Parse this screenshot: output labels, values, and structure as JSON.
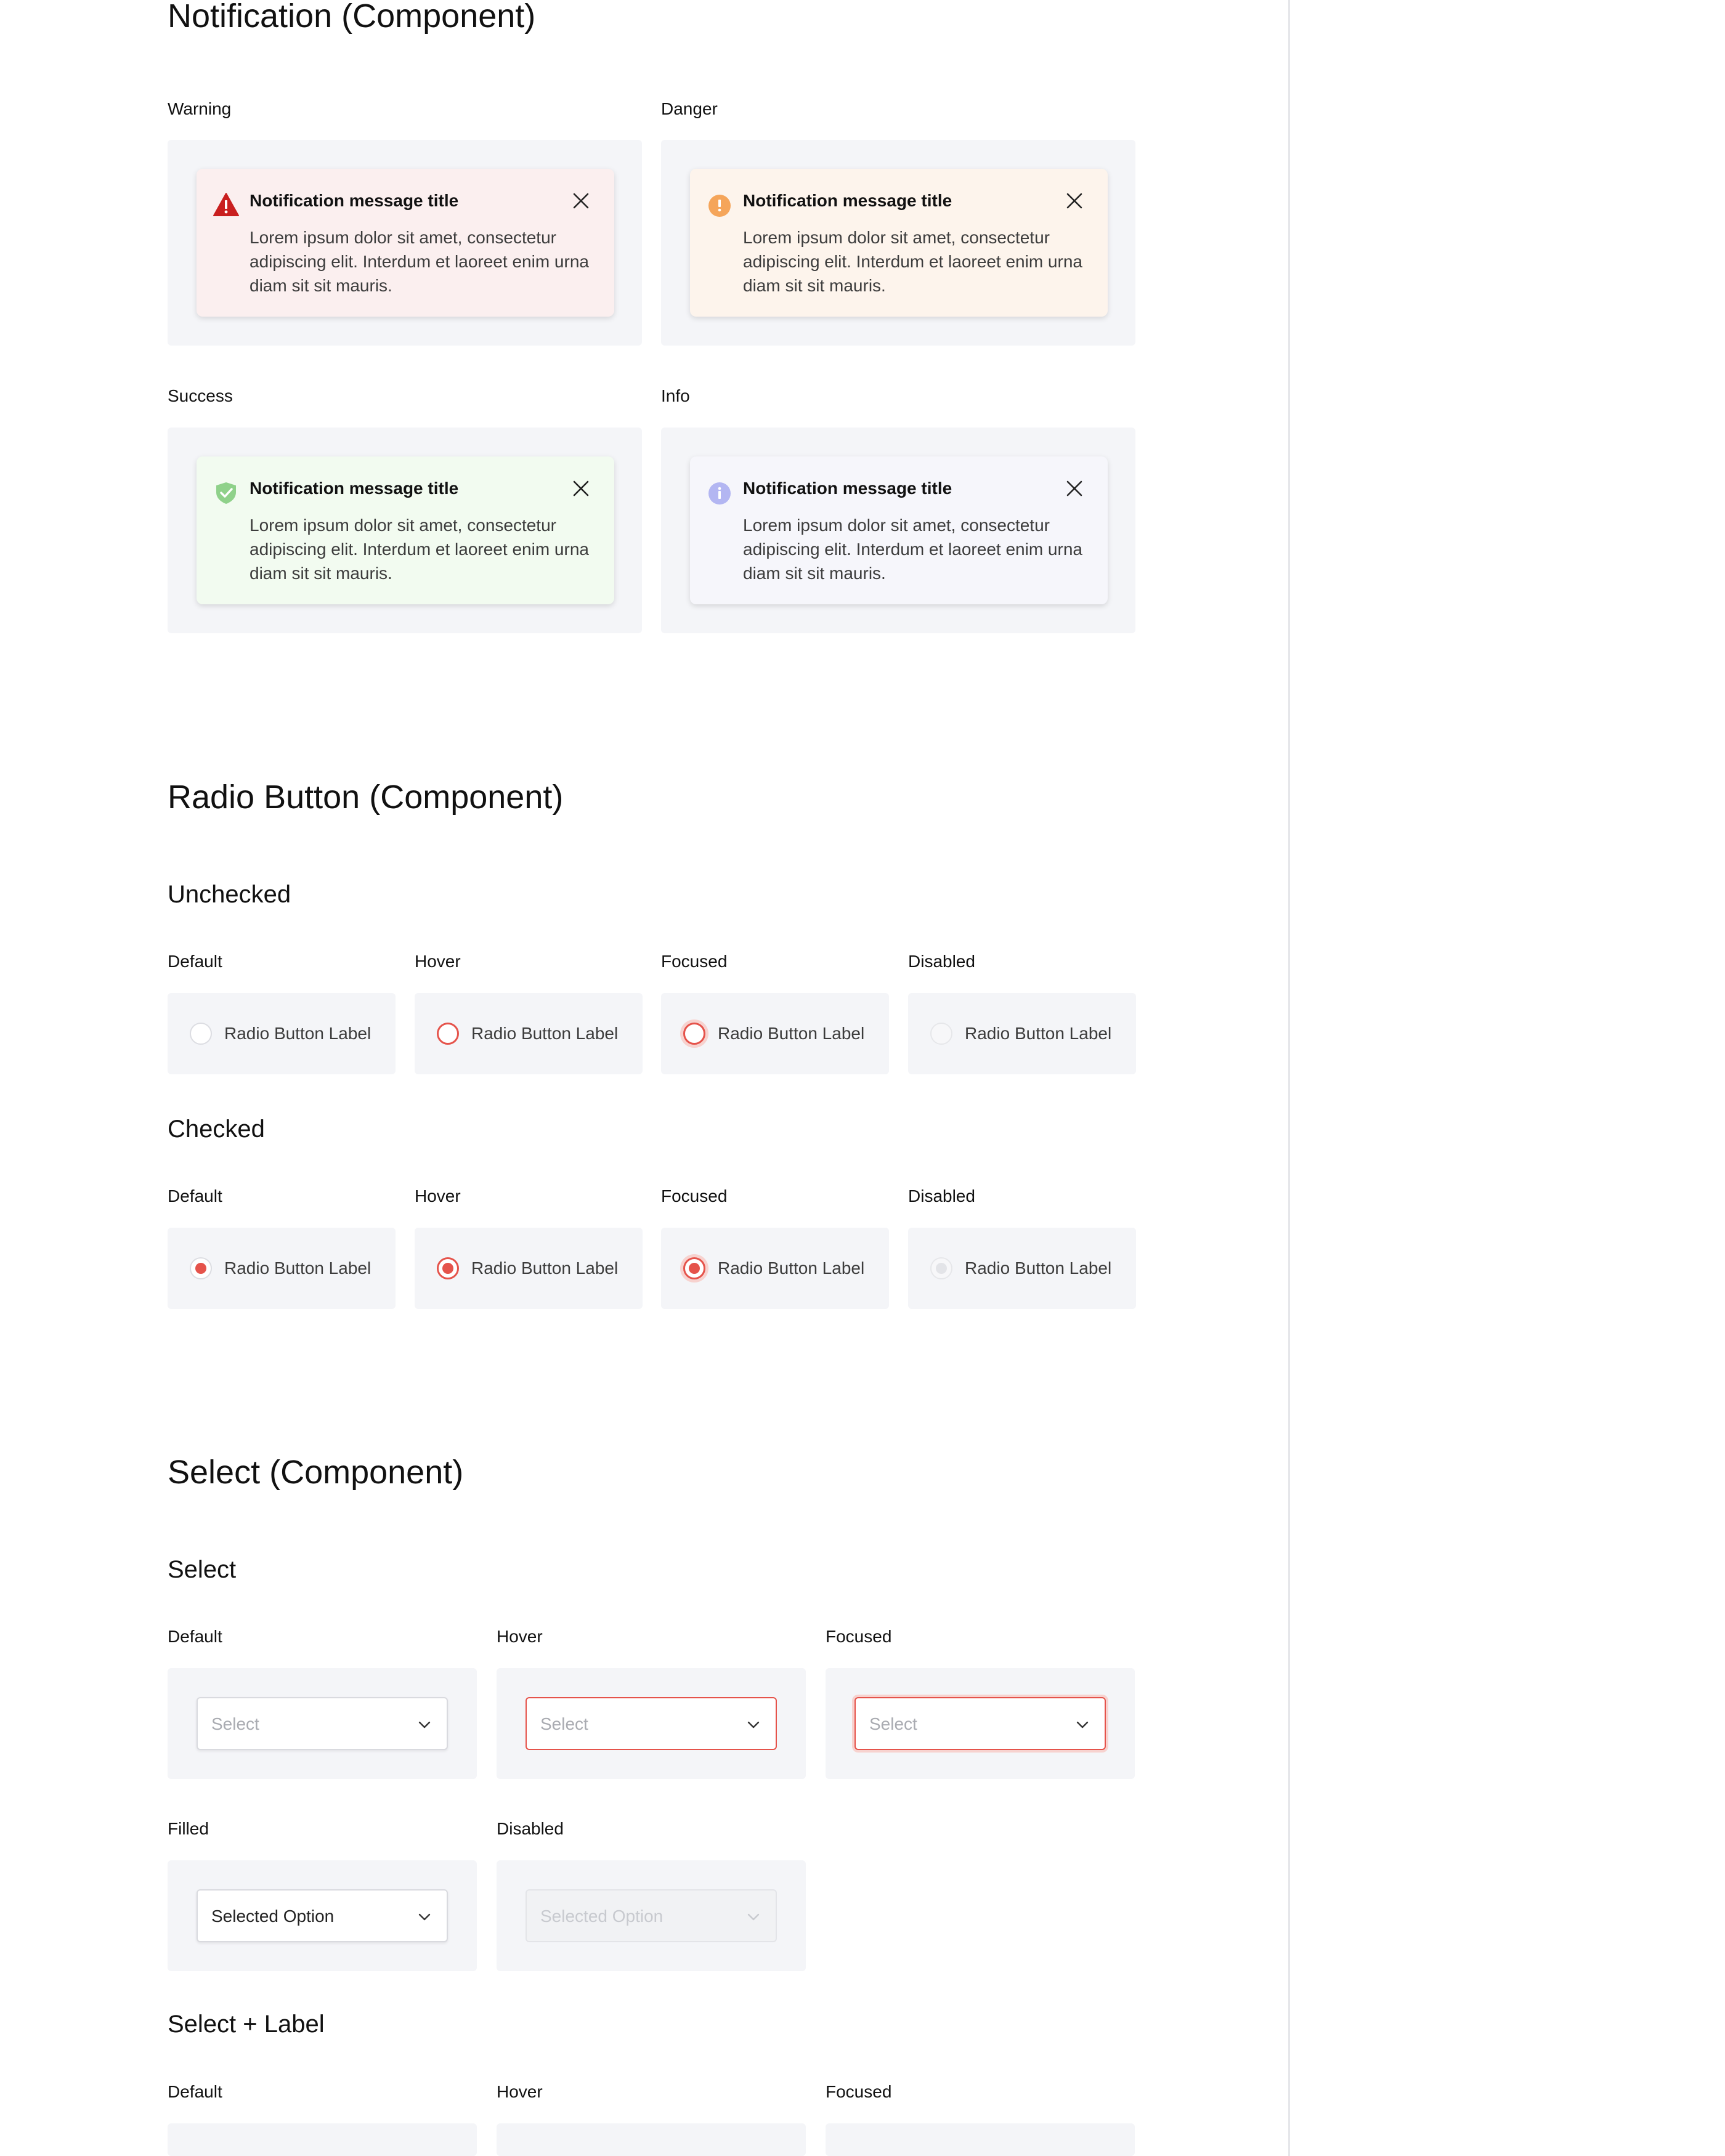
{
  "notification": {
    "heading": "Notification (Component)",
    "variants": [
      {
        "label": "Warning",
        "title": "Notification message title",
        "message": "Lorem ipsum dolor sit amet, consectetur adipiscing elit. Interdum et laoreet enim urna diam sit sit mauris.",
        "icon": "warning-triangle-icon",
        "accent": "#c91f1f",
        "background": "#fbefef"
      },
      {
        "label": "Danger",
        "title": "Notification message title",
        "message": "Lorem ipsum dolor sit amet, consectetur adipiscing elit. Interdum et laoreet enim urna diam sit sit mauris.",
        "icon": "exclamation-circle-icon",
        "accent": "#f5a55a",
        "background": "#fdf4ec"
      },
      {
        "label": "Success",
        "title": "Notification message title",
        "message": "Lorem ipsum dolor sit amet, consectetur adipiscing elit. Interdum et laoreet enim urna diam sit sit mauris.",
        "icon": "shield-check-icon",
        "accent": "#8fd18a",
        "background": "#f2fbf0"
      },
      {
        "label": "Info",
        "title": "Notification message title",
        "message": "Lorem ipsum dolor sit amet, consectetur adipiscing elit. Interdum et laoreet enim urna diam sit sit mauris.",
        "icon": "info-circle-icon",
        "accent": "#b3b6f2",
        "background": "#f6f6fb"
      }
    ],
    "close_icon": "close-icon"
  },
  "radio": {
    "heading": "Radio Button (Component)",
    "unchecked": {
      "title": "Unchecked",
      "states": [
        {
          "label": "Default",
          "text": "Radio Button Label"
        },
        {
          "label": "Hover",
          "text": "Radio Button Label"
        },
        {
          "label": "Focused",
          "text": "Radio Button Label"
        },
        {
          "label": "Disabled",
          "text": "Radio Button Label"
        }
      ]
    },
    "checked": {
      "title": "Checked",
      "states": [
        {
          "label": "Default",
          "text": "Radio Button Label"
        },
        {
          "label": "Hover",
          "text": "Radio Button Label"
        },
        {
          "label": "Focused",
          "text": "Radio Button Label"
        },
        {
          "label": "Disabled",
          "text": "Radio Button Label"
        }
      ]
    },
    "accent": "#e5534b"
  },
  "select": {
    "heading": "Select (Component)",
    "select_group": {
      "title": "Select",
      "states": [
        {
          "label": "Default",
          "value": "Select"
        },
        {
          "label": "Hover",
          "value": "Select"
        },
        {
          "label": "Focused",
          "value": "Select"
        },
        {
          "label": "Filled",
          "value": "Selected Option"
        },
        {
          "label": "Disabled",
          "value": "Selected Option"
        }
      ]
    },
    "select_label_group": {
      "title": "Select + Label",
      "states": [
        {
          "label": "Default"
        },
        {
          "label": "Hover"
        },
        {
          "label": "Focused"
        }
      ]
    },
    "chevron_icon": "chevron-down-icon",
    "accent": "#e5534b"
  }
}
